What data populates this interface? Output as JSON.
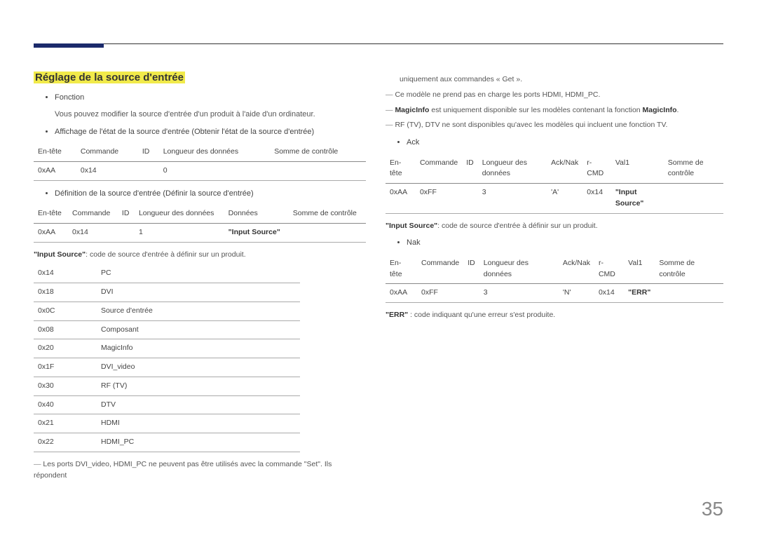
{
  "pageNumber": "35",
  "heading": "Réglage de la source d'entrée",
  "bullet_fonction": "Fonction",
  "fonction_desc": "Vous pouvez modifier la source d'entrée d'un produit à l'aide d'un ordinateur.",
  "bullet_affichage": "Affichage de l'état de la source d'entrée (Obtenir l'état de la source d'entrée)",
  "t1": {
    "h": [
      "En-tête",
      "Commande",
      "ID",
      "Longueur des données",
      "Somme de contrôle"
    ],
    "r": [
      "0xAA",
      "0x14",
      "",
      "0",
      ""
    ]
  },
  "bullet_definition": "Définition de la source d'entrée (Définir la source d'entrée)",
  "t2": {
    "h": [
      "En-tête",
      "Commande",
      "ID",
      "Longueur des données",
      "Données",
      "Somme de contrôle"
    ],
    "r": [
      "0xAA",
      "0x14",
      "",
      "1",
      "\"Input Source\"",
      ""
    ]
  },
  "inputsrc_def": "\"Input Source\": code de source d'entrée à définir sur un produit.",
  "src": [
    [
      "0x14",
      "PC"
    ],
    [
      "0x18",
      "DVI"
    ],
    [
      "0x0C",
      "Source d'entrée"
    ],
    [
      "0x08",
      "Composant"
    ],
    [
      "0x20",
      "MagicInfo"
    ],
    [
      "0x1F",
      "DVI_video"
    ],
    [
      "0x30",
      "RF (TV)"
    ],
    [
      "0x40",
      "DTV"
    ],
    [
      "0x21",
      "HDMI"
    ],
    [
      "0x22",
      "HDMI_PC"
    ]
  ],
  "note_ports": "Les ports DVI_video, HDMI_PC ne peuvent pas être utilisés avec la commande \"Set\". Ils répondent",
  "col2_continue": "uniquement aux commandes « Get ».",
  "note_model": "Ce modèle ne prend pas en charge les ports HDMI, HDMI_PC.",
  "note_magic_pre": "MagicInfo",
  "note_magic_mid": " est uniquement disponible sur les modèles contenant la fonction ",
  "note_magic_post": "MagicInfo",
  "note_magic_end": ".",
  "note_rf": "RF (TV), DTV ne sont disponibles qu'avec les modèles qui incluent une fonction TV.",
  "bullet_ack": "Ack",
  "t3": {
    "h": [
      "En-tête",
      "Commande",
      "ID",
      "Longueur des données",
      "Ack/Nak",
      "r-CMD",
      "Val1",
      "Somme de contrôle"
    ],
    "r": [
      "0xAA",
      "0xFF",
      "",
      "3",
      "'A'",
      "0x14",
      "\"Input Source\"",
      ""
    ]
  },
  "inputsrc_def2": "\"Input Source\": code de source d'entrée à définir sur un produit.",
  "bullet_nak": "Nak",
  "t4": {
    "h": [
      "En-tête",
      "Commande",
      "ID",
      "Longueur des données",
      "Ack/Nak",
      "r-CMD",
      "Val1",
      "Somme de contrôle"
    ],
    "r": [
      "0xAA",
      "0xFF",
      "",
      "3",
      "'N'",
      "0x14",
      "\"ERR\"",
      ""
    ]
  },
  "err_def": "\"ERR\" : code indiquant qu'une erreur s'est produite."
}
